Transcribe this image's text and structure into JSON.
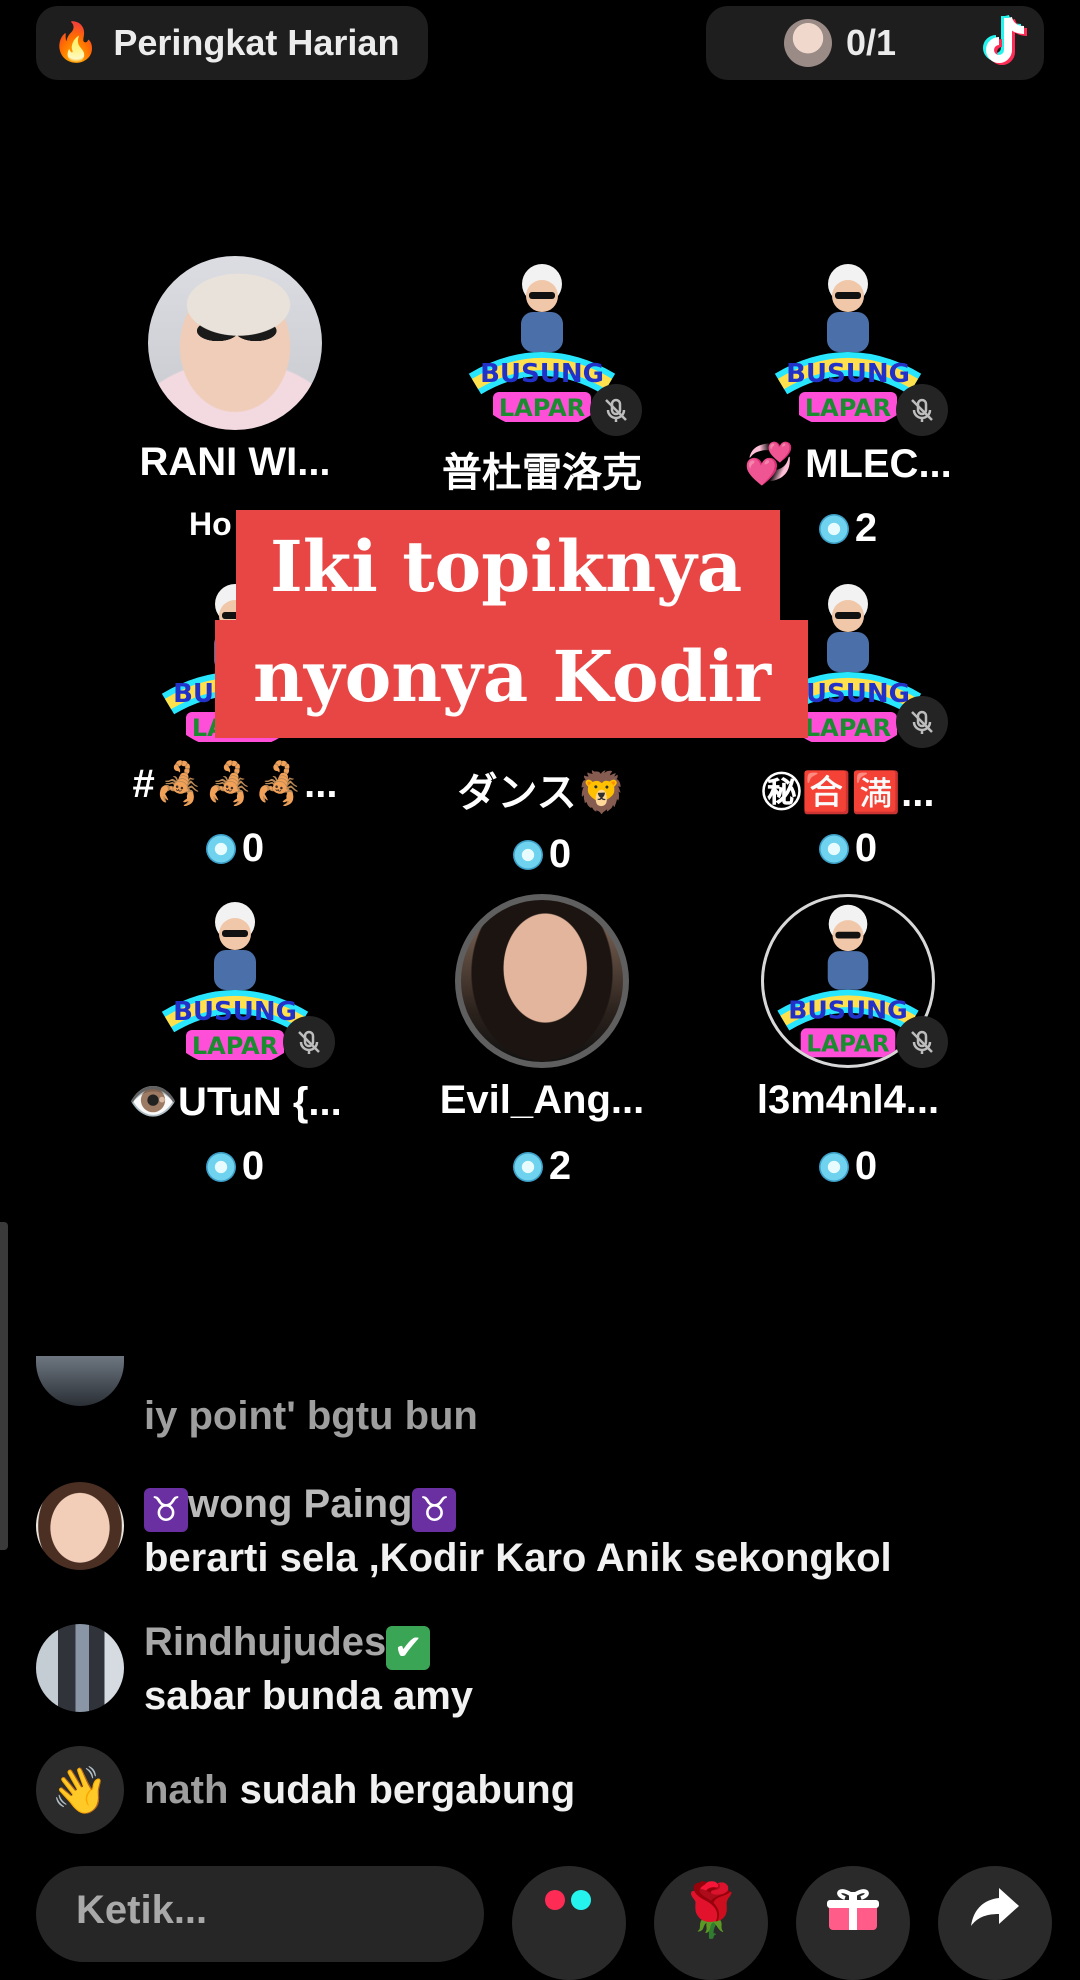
{
  "header": {
    "ranking_icon": "flame-icon",
    "ranking_label": "Peringkat Harian",
    "viewer_count": "0/1",
    "brand_icon": "tiktok-logo-icon"
  },
  "seats": [
    {
      "name": "RANI WI...",
      "score": "Ho",
      "avatar": "photo",
      "muted": false,
      "is_host": true
    },
    {
      "name": "普杜雷洛克",
      "score": "",
      "avatar": "sticker",
      "muted": true
    },
    {
      "name": "💞 MLEC...",
      "score": "2",
      "avatar": "sticker",
      "muted": true
    },
    {
      "name": "#🦂🦂🦂...",
      "score": "0",
      "avatar": "sticker",
      "muted": false
    },
    {
      "name": "ダンス🦁",
      "score": "0",
      "avatar": "sticker",
      "muted": false
    },
    {
      "name": "㊙🈴🈵...",
      "score": "0",
      "avatar": "sticker",
      "muted": true
    },
    {
      "name": "👁️UTuN {...",
      "score": "0",
      "avatar": "sticker",
      "muted": true
    },
    {
      "name": "Evil_Ang...",
      "score": "2",
      "avatar": "photo",
      "muted": false
    },
    {
      "name": "l3m4nl4...",
      "score": "0",
      "avatar": "sticker",
      "muted": true
    }
  ],
  "sticker_text": "BUSUNG LAPAR",
  "caption": {
    "line1": "Iki topiknya",
    "line2": "nyonya Kodir",
    "color": "#e84545"
  },
  "chat": [
    {
      "name": "",
      "message": "iy point' bgtu bun"
    },
    {
      "name": "wong Paing",
      "name_prefix": "♉",
      "name_suffix": "♉",
      "message": "berarti sela ,Kodir Karo Anik sekongkol"
    },
    {
      "name": "Rindhujudes",
      "name_suffix": "✔",
      "message": "sabar bunda amy"
    },
    {
      "name": "nath",
      "message": "sudah bergabung",
      "icon": "wave-hand-icon"
    }
  ],
  "footer": {
    "input_placeholder": "Ketik...",
    "buttons": [
      "multi-guest-icon",
      "rose-gift-icon",
      "gift-box-icon",
      "share-icon"
    ]
  }
}
